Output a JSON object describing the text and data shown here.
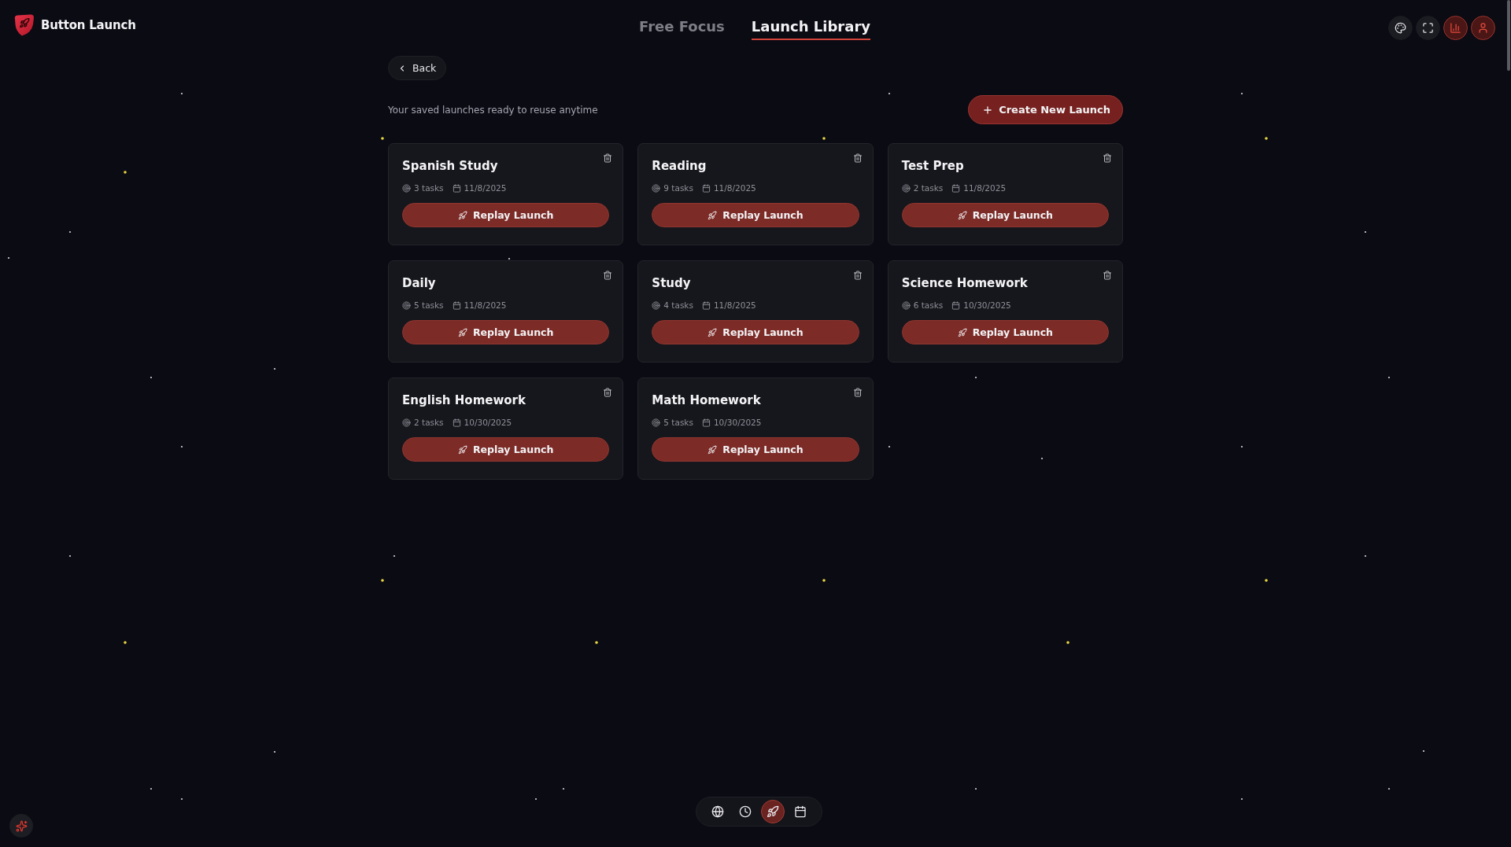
{
  "app": {
    "name": "Button Launch"
  },
  "nav_tabs": [
    {
      "label": "Free Focus",
      "selected": false
    },
    {
      "label": "Launch Library",
      "selected": true
    }
  ],
  "toolbar_buttons": [
    {
      "kind": "palette",
      "highlighted": false
    },
    {
      "kind": "fullscreen",
      "highlighted": false
    },
    {
      "kind": "stats",
      "highlighted": true
    },
    {
      "kind": "profile",
      "highlighted": true
    }
  ],
  "back_button": {
    "label": "Back"
  },
  "subtitle": "Your saved launches ready to reuse anytime",
  "create_button": {
    "label": "Create New Launch"
  },
  "launches": [
    {
      "title": "Spanish Study",
      "tasks": "3 tasks",
      "date": "11/8/2025",
      "action": "Replay Launch"
    },
    {
      "title": "Reading",
      "tasks": "9 tasks",
      "date": "11/8/2025",
      "action": "Replay Launch"
    },
    {
      "title": "Test Prep",
      "tasks": "2 tasks",
      "date": "11/8/2025",
      "action": "Replay Launch"
    },
    {
      "title": "Daily",
      "tasks": "5 tasks",
      "date": "11/8/2025",
      "action": "Replay Launch"
    },
    {
      "title": "Study",
      "tasks": "4 tasks",
      "date": "11/8/2025",
      "action": "Replay Launch"
    },
    {
      "title": "Science Homework",
      "tasks": "6 tasks",
      "date": "10/30/2025",
      "action": "Replay Launch"
    },
    {
      "title": "English Homework",
      "tasks": "2 tasks",
      "date": "10/30/2025",
      "action": "Replay Launch"
    },
    {
      "title": "Math Homework",
      "tasks": "5 tasks",
      "date": "10/30/2025",
      "action": "Replay Launch"
    }
  ],
  "dock": [
    {
      "kind": "globe",
      "selected": false
    },
    {
      "kind": "clock",
      "selected": false
    },
    {
      "kind": "rocket",
      "selected": true
    },
    {
      "kind": "calendar",
      "selected": false
    }
  ]
}
